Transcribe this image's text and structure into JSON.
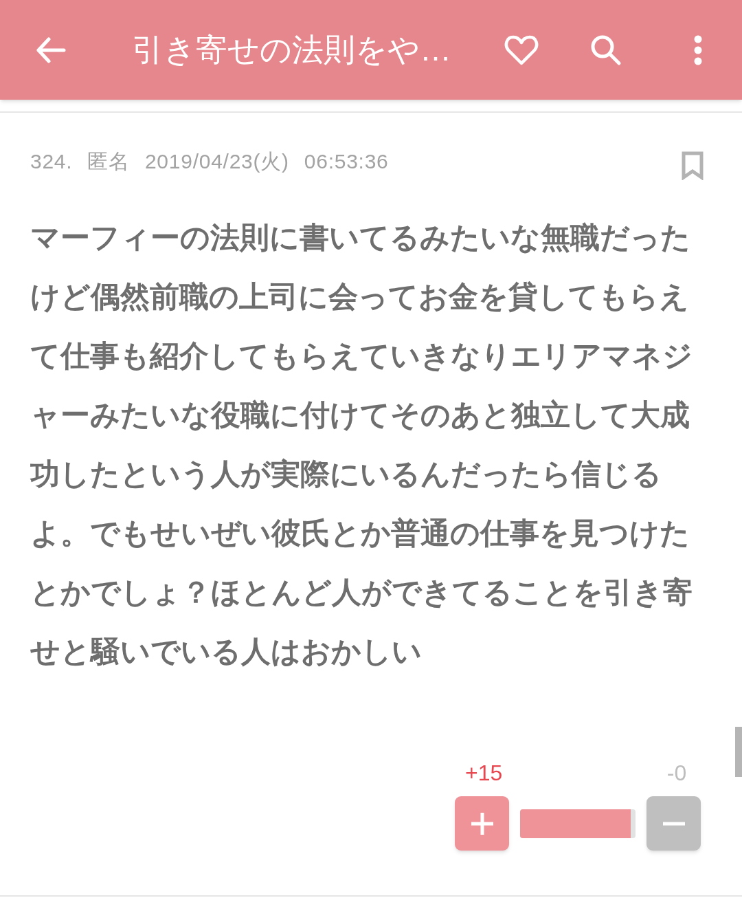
{
  "app_bar": {
    "title": "引き寄せの法則をや…"
  },
  "post": {
    "number": "324.",
    "author": "匿名",
    "date": "2019/04/23(火)",
    "time": "06:53:36",
    "bookmarked": false,
    "body": "マーフィーの法則に書いてるみたいな無職だったけど偶然前職の上司に会ってお金を貸してもらえて仕事も紹介してもらえていきなりエリアマネジャーみたいな役職に付けてそのあと独立して大成功したという人が実際にいるんだったら信じるよ。でもせいぜい彼氏とか普通の仕事を見つけたとかでしょ？ほとんど人ができてることを引き寄せと騒いでいる人はおかしい",
    "votes": {
      "plus": "+15",
      "minus": "-0",
      "level": 0.96
    }
  }
}
